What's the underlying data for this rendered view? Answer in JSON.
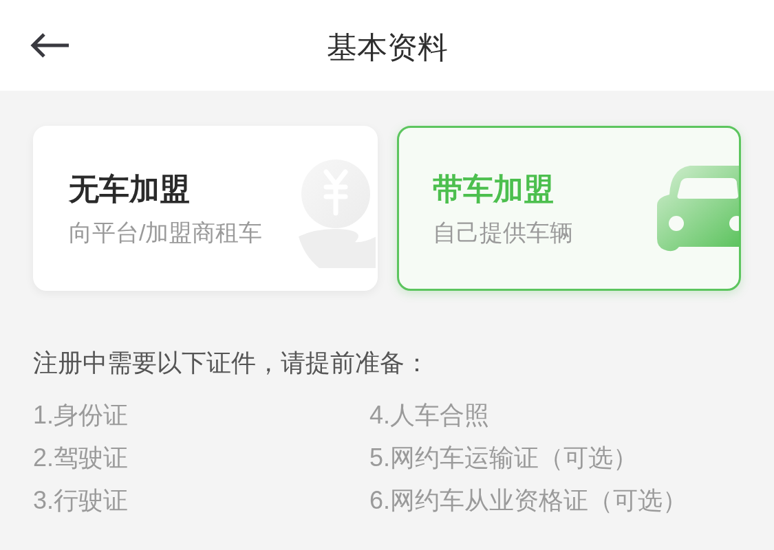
{
  "header": {
    "title": "基本资料"
  },
  "join_options": [
    {
      "kind": "rent",
      "title": "无车加盟",
      "subtitle": "向平台/加盟商租车",
      "selected": false
    },
    {
      "kind": "own_car",
      "title": "带车加盟",
      "subtitle": "自己提供车辆",
      "selected": true
    }
  ],
  "requirements": {
    "heading": "注册中需要以下证件，请提前准备：",
    "items": [
      "1.身份证",
      "2.驾驶证",
      "3.行驶证",
      "4.人车合照",
      "5.网约车运输证（可选）",
      "6.网约车从业资格证（可选）"
    ]
  }
}
